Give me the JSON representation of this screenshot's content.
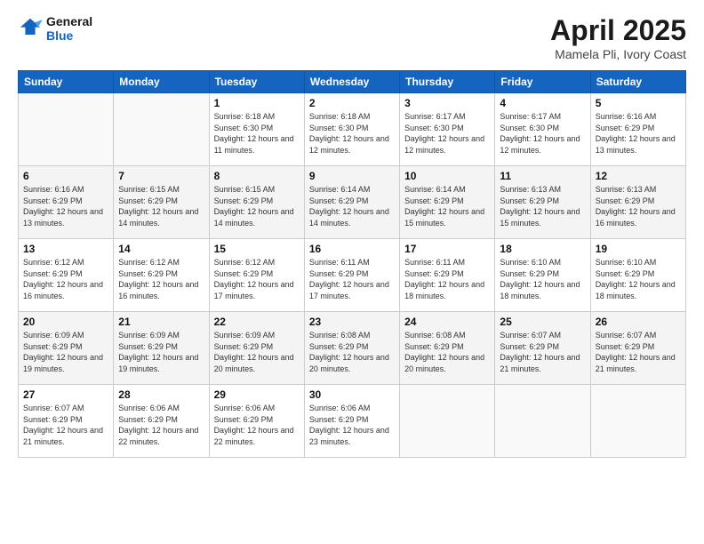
{
  "header": {
    "logo_line1": "General",
    "logo_line2": "Blue",
    "title": "April 2025",
    "subtitle": "Mamela Pli, Ivory Coast"
  },
  "calendar": {
    "days_of_week": [
      "Sunday",
      "Monday",
      "Tuesday",
      "Wednesday",
      "Thursday",
      "Friday",
      "Saturday"
    ],
    "weeks": [
      [
        {
          "day": "",
          "info": ""
        },
        {
          "day": "",
          "info": ""
        },
        {
          "day": "1",
          "info": "Sunrise: 6:18 AM\nSunset: 6:30 PM\nDaylight: 12 hours and 11 minutes."
        },
        {
          "day": "2",
          "info": "Sunrise: 6:18 AM\nSunset: 6:30 PM\nDaylight: 12 hours and 12 minutes."
        },
        {
          "day": "3",
          "info": "Sunrise: 6:17 AM\nSunset: 6:30 PM\nDaylight: 12 hours and 12 minutes."
        },
        {
          "day": "4",
          "info": "Sunrise: 6:17 AM\nSunset: 6:30 PM\nDaylight: 12 hours and 12 minutes."
        },
        {
          "day": "5",
          "info": "Sunrise: 6:16 AM\nSunset: 6:29 PM\nDaylight: 12 hours and 13 minutes."
        }
      ],
      [
        {
          "day": "6",
          "info": "Sunrise: 6:16 AM\nSunset: 6:29 PM\nDaylight: 12 hours and 13 minutes."
        },
        {
          "day": "7",
          "info": "Sunrise: 6:15 AM\nSunset: 6:29 PM\nDaylight: 12 hours and 14 minutes."
        },
        {
          "day": "8",
          "info": "Sunrise: 6:15 AM\nSunset: 6:29 PM\nDaylight: 12 hours and 14 minutes."
        },
        {
          "day": "9",
          "info": "Sunrise: 6:14 AM\nSunset: 6:29 PM\nDaylight: 12 hours and 14 minutes."
        },
        {
          "day": "10",
          "info": "Sunrise: 6:14 AM\nSunset: 6:29 PM\nDaylight: 12 hours and 15 minutes."
        },
        {
          "day": "11",
          "info": "Sunrise: 6:13 AM\nSunset: 6:29 PM\nDaylight: 12 hours and 15 minutes."
        },
        {
          "day": "12",
          "info": "Sunrise: 6:13 AM\nSunset: 6:29 PM\nDaylight: 12 hours and 16 minutes."
        }
      ],
      [
        {
          "day": "13",
          "info": "Sunrise: 6:12 AM\nSunset: 6:29 PM\nDaylight: 12 hours and 16 minutes."
        },
        {
          "day": "14",
          "info": "Sunrise: 6:12 AM\nSunset: 6:29 PM\nDaylight: 12 hours and 16 minutes."
        },
        {
          "day": "15",
          "info": "Sunrise: 6:12 AM\nSunset: 6:29 PM\nDaylight: 12 hours and 17 minutes."
        },
        {
          "day": "16",
          "info": "Sunrise: 6:11 AM\nSunset: 6:29 PM\nDaylight: 12 hours and 17 minutes."
        },
        {
          "day": "17",
          "info": "Sunrise: 6:11 AM\nSunset: 6:29 PM\nDaylight: 12 hours and 18 minutes."
        },
        {
          "day": "18",
          "info": "Sunrise: 6:10 AM\nSunset: 6:29 PM\nDaylight: 12 hours and 18 minutes."
        },
        {
          "day": "19",
          "info": "Sunrise: 6:10 AM\nSunset: 6:29 PM\nDaylight: 12 hours and 18 minutes."
        }
      ],
      [
        {
          "day": "20",
          "info": "Sunrise: 6:09 AM\nSunset: 6:29 PM\nDaylight: 12 hours and 19 minutes."
        },
        {
          "day": "21",
          "info": "Sunrise: 6:09 AM\nSunset: 6:29 PM\nDaylight: 12 hours and 19 minutes."
        },
        {
          "day": "22",
          "info": "Sunrise: 6:09 AM\nSunset: 6:29 PM\nDaylight: 12 hours and 20 minutes."
        },
        {
          "day": "23",
          "info": "Sunrise: 6:08 AM\nSunset: 6:29 PM\nDaylight: 12 hours and 20 minutes."
        },
        {
          "day": "24",
          "info": "Sunrise: 6:08 AM\nSunset: 6:29 PM\nDaylight: 12 hours and 20 minutes."
        },
        {
          "day": "25",
          "info": "Sunrise: 6:07 AM\nSunset: 6:29 PM\nDaylight: 12 hours and 21 minutes."
        },
        {
          "day": "26",
          "info": "Sunrise: 6:07 AM\nSunset: 6:29 PM\nDaylight: 12 hours and 21 minutes."
        }
      ],
      [
        {
          "day": "27",
          "info": "Sunrise: 6:07 AM\nSunset: 6:29 PM\nDaylight: 12 hours and 21 minutes."
        },
        {
          "day": "28",
          "info": "Sunrise: 6:06 AM\nSunset: 6:29 PM\nDaylight: 12 hours and 22 minutes."
        },
        {
          "day": "29",
          "info": "Sunrise: 6:06 AM\nSunset: 6:29 PM\nDaylight: 12 hours and 22 minutes."
        },
        {
          "day": "30",
          "info": "Sunrise: 6:06 AM\nSunset: 6:29 PM\nDaylight: 12 hours and 23 minutes."
        },
        {
          "day": "",
          "info": ""
        },
        {
          "day": "",
          "info": ""
        },
        {
          "day": "",
          "info": ""
        }
      ]
    ]
  }
}
